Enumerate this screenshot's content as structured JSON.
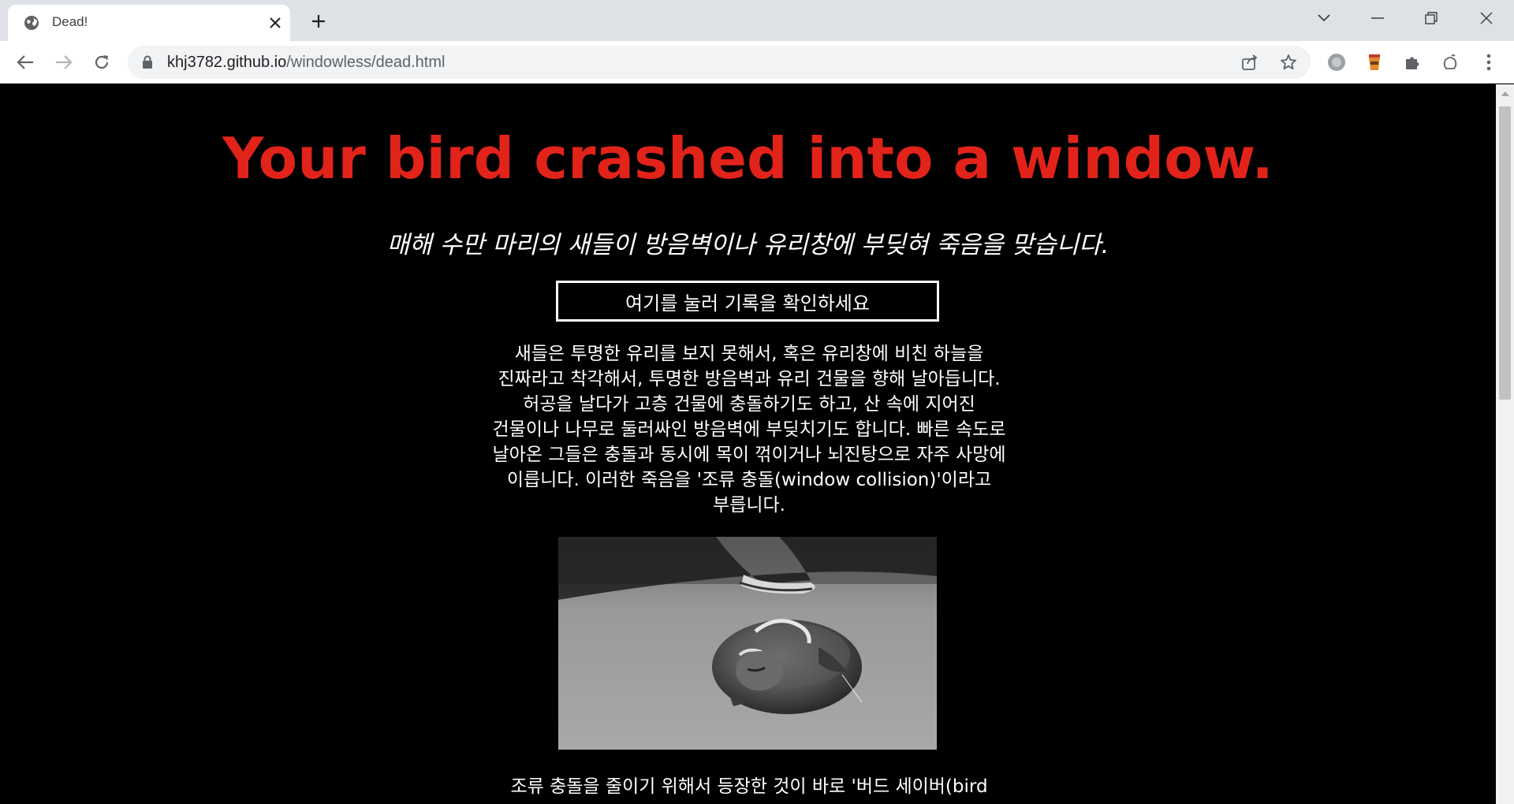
{
  "browser": {
    "tab_title": "Dead!",
    "url_host": "khj3782.github.io",
    "url_path": "/windowless/dead.html"
  },
  "page": {
    "headline": "Your bird crashed into a window.",
    "subtitle": "매해 수만 마리의 새들이 방음벽이나 유리창에 부딪혀 죽음을 맞습니다.",
    "record_button": "여기를 눌러 기록을 확인하세요",
    "paragraph_lines": [
      "새들은 투명한 유리를 보지 못해서, 혹은 유리창에 비친 하늘을",
      "진짜라고 착각해서, 투명한 방음벽과 유리 건물을 향해 날아듭니다.",
      "허공을 날다가 고층 건물에 충돌하기도 하고, 산 속에 지어진",
      "건물이나 나무로 둘러싸인 방음벽에 부딪치기도 합니다. 빠른 속도로",
      "날아온 그들은 충돌과 동시에 목이 꺾이거나 뇌진탕으로 자주 사망에",
      "이릅니다. 이러한 죽음을 '조류 충돌(window collision)'이라고",
      "부릅니다."
    ],
    "paragraph2_line": "조류 충돌을 줄이기 위해서 등장한 것이 바로 '버드 세이버(bird"
  },
  "colors": {
    "headline": "#e2231a",
    "background": "#000000",
    "text": "#ffffff"
  }
}
